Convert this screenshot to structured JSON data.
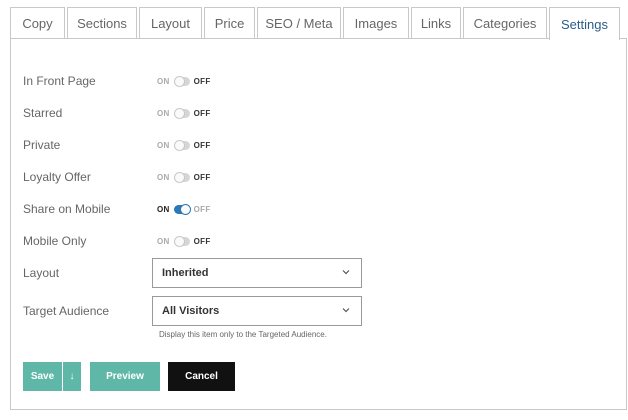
{
  "tabs": [
    {
      "label": "Copy"
    },
    {
      "label": "Sections"
    },
    {
      "label": "Layout"
    },
    {
      "label": "Price"
    },
    {
      "label": "SEO / Meta"
    },
    {
      "label": "Images"
    },
    {
      "label": "Links"
    },
    {
      "label": "Categories"
    },
    {
      "label": "Settings",
      "active": true
    }
  ],
  "settings": {
    "toggle_on_text": "ON",
    "toggle_off_text": "OFF",
    "toggles": [
      {
        "label": "In Front Page",
        "state": "off"
      },
      {
        "label": "Starred",
        "state": "off"
      },
      {
        "label": "Private",
        "state": "off"
      },
      {
        "label": "Loyalty Offer",
        "state": "off"
      },
      {
        "label": "Share on Mobile",
        "state": "on"
      },
      {
        "label": "Mobile Only",
        "state": "off"
      }
    ],
    "layout": {
      "label": "Layout",
      "value": "Inherited"
    },
    "target_audience": {
      "label": "Target Audience",
      "value": "All Visitors",
      "hint": "Display this item only to the Targeted Audience."
    }
  },
  "actions": {
    "save_label": "Save",
    "save_menu_glyph": "↓",
    "preview_label": "Preview",
    "cancel_label": "Cancel"
  },
  "colors": {
    "accent_teal": "#5fb8a7",
    "toggle_on": "#2a78b6",
    "cancel_bg": "#111111",
    "active_tab_text": "#2a5d8a"
  }
}
